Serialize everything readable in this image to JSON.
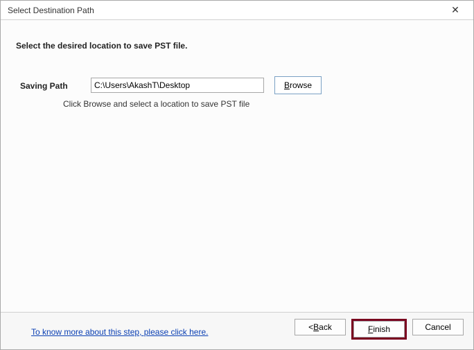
{
  "window": {
    "title": "Select Destination Path",
    "close_glyph": "✕"
  },
  "main": {
    "instruction": "Select the desired location to save PST file.",
    "saving_path_label": "Saving Path",
    "saving_path_value": "C:\\Users\\AkashT\\Desktop",
    "browse_prefix": "B",
    "browse_rest": "rowse",
    "hint": "Click Browse and select a location to save PST file"
  },
  "footer": {
    "help_link": "To know more about this step, please click here.",
    "back_prefix": "< ",
    "back_ul": "B",
    "back_rest": "ack",
    "finish_ul": "F",
    "finish_rest": "inish",
    "cancel": "Cancel"
  }
}
